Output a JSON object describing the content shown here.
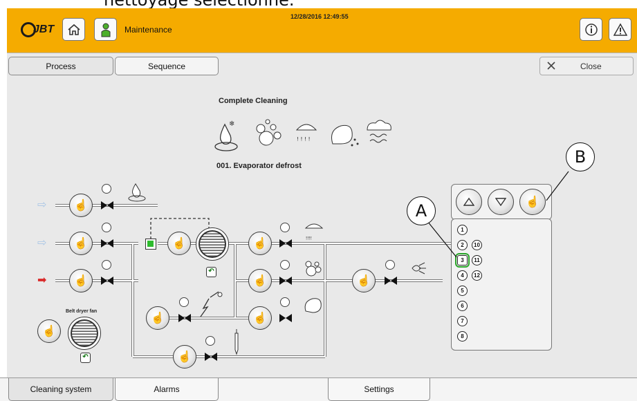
{
  "caption": "nettoyage sélectionné.",
  "header": {
    "logo_text": "JBT",
    "title": "Maintenance",
    "datetime": "12/28/2016 12:49:55",
    "icons": [
      "home-icon",
      "user-icon",
      "info-icon",
      "warning-icon"
    ]
  },
  "tabs_top": {
    "process": "Process",
    "sequence": "Sequence",
    "close": "Close"
  },
  "process": {
    "program_title": "Complete Cleaning",
    "current_step": "001. Evaporator defrost",
    "belt_label": "Belt dryer fan"
  },
  "steps": {
    "items": [
      "1",
      "2",
      "3",
      "4",
      "5",
      "6",
      "7",
      "8",
      "10",
      "11",
      "12"
    ],
    "active": "3"
  },
  "callouts": {
    "a": "A",
    "b": "B"
  },
  "bottom_tabs": {
    "cleaning": "Cleaning system",
    "alarms": "Alarms",
    "settings": "Settings"
  },
  "colors": {
    "header_bg": "#f5ab00",
    "active_step": "#2aa52a",
    "arrow_blue": "#a9c6e6",
    "arrow_red": "#d92a2a"
  }
}
